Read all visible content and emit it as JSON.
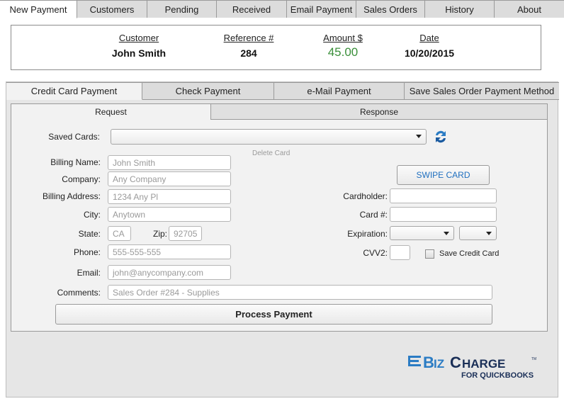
{
  "top_tabs": [
    {
      "label": "New Payment"
    },
    {
      "label": "Customers"
    },
    {
      "label": "Pending"
    },
    {
      "label": "Received"
    },
    {
      "label": "Email Payment"
    },
    {
      "label": "Sales Orders"
    },
    {
      "label": "History"
    },
    {
      "label": "About"
    }
  ],
  "summary": {
    "customer_label": "Customer",
    "customer_value": "John Smith",
    "reference_label": "Reference #",
    "reference_value": "284",
    "amount_label": "Amount $",
    "amount_value": "45.00",
    "date_label": "Date",
    "date_value": "10/20/2015"
  },
  "payment_tabs": [
    {
      "label": "Credit Card Payment"
    },
    {
      "label": "Check Payment"
    },
    {
      "label": "e-Mail Payment"
    },
    {
      "label": "Save Sales Order Payment Method"
    }
  ],
  "inner_tabs": [
    {
      "label": "Request"
    },
    {
      "label": "Response"
    }
  ],
  "form": {
    "saved_cards_label": "Saved Cards:",
    "delete_card_label": "Delete Card",
    "billing_name_label": "Billing Name:",
    "billing_name_placeholder": "John Smith",
    "company_label": "Company:",
    "company_placeholder": "Any Company",
    "billing_address_label": "Billing Address:",
    "billing_address_placeholder": "1234 Any Pl",
    "city_label": "City:",
    "city_placeholder": "Anytown",
    "state_label": "State:",
    "state_placeholder": "CA",
    "zip_label": "Zip:",
    "zip_placeholder": "92705",
    "phone_label": "Phone:",
    "phone_placeholder": "555-555-555",
    "email_label": "Email:",
    "email_placeholder": "john@anycompany.com",
    "comments_label": "Comments:",
    "comments_placeholder": "Sales Order #284 - Supplies",
    "swipe_card_label": "SWIPE CARD",
    "cardholder_label": "Cardholder:",
    "card_number_label": "Card #:",
    "expiration_label": "Expiration:",
    "cvv2_label": "CVV2:",
    "save_credit_card_label": "Save Credit Card",
    "process_payment_label": "Process Payment"
  },
  "logo": {
    "name": "EBizCharge",
    "tagline": "FOR QUICKBOOKS",
    "trademark": "TM"
  },
  "colors": {
    "amount": "#3a8f3a",
    "swipe_text": "#1f6fbf",
    "logo_blue": "#2b7cc4",
    "logo_dark": "#1a2f57"
  }
}
